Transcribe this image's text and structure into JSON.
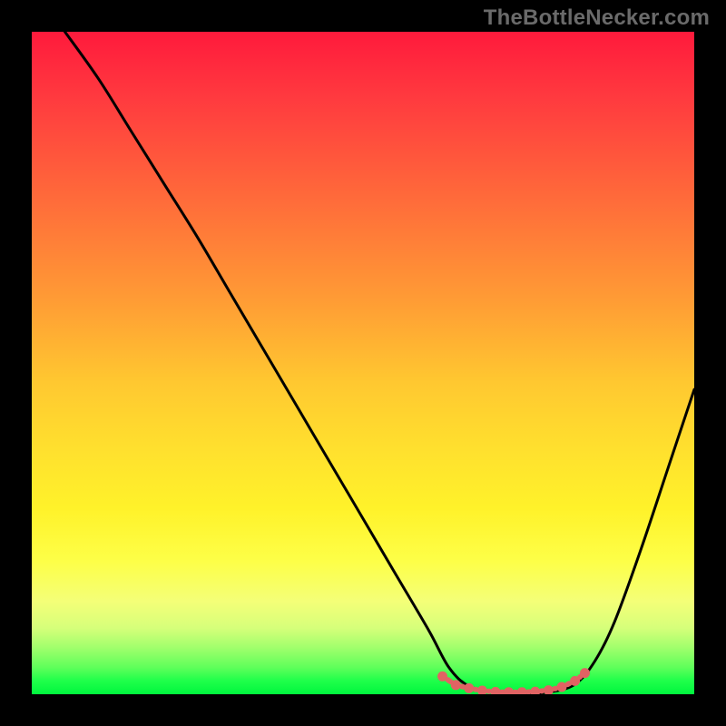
{
  "watermark": "TheBottleNecker.com",
  "colors": {
    "frame": "#000000",
    "curve": "#000000",
    "marker": "#e06363",
    "watermark": "#6a6a6a",
    "gradient_stops": [
      "#ff1a3c",
      "#ff3a3f",
      "#ff6a3a",
      "#ff9a35",
      "#ffc830",
      "#ffe02e",
      "#fff22a",
      "#fdff48",
      "#f4ff78",
      "#d6ff7a",
      "#a0ff6c",
      "#5eff5a",
      "#1eff4a",
      "#00f63e"
    ]
  },
  "chart_data": {
    "type": "line",
    "title": "",
    "xlabel": "",
    "ylabel": "",
    "xlim": [
      0,
      100
    ],
    "ylim": [
      0,
      100
    ],
    "series": [
      {
        "name": "curve",
        "x": [
          5,
          10,
          15,
          20,
          25,
          30,
          35,
          40,
          45,
          50,
          55,
          60,
          63,
          66,
          70,
          74,
          78,
          82,
          85,
          88,
          92,
          96,
          100
        ],
        "y": [
          100,
          93,
          85,
          77,
          69,
          60.5,
          52,
          43.5,
          35,
          26.5,
          18,
          9.5,
          4,
          1.2,
          0.3,
          0.2,
          0.3,
          1.5,
          5,
          11,
          22,
          34,
          46
        ]
      }
    ],
    "markers": {
      "name": "bottom-highlight",
      "style": "red-dots-and-dashes",
      "x": [
        62,
        64,
        66,
        68,
        70,
        72,
        74,
        76,
        78,
        80,
        82,
        83.5
      ],
      "y": [
        2.7,
        1.4,
        0.9,
        0.55,
        0.35,
        0.3,
        0.3,
        0.4,
        0.6,
        1.1,
        2.0,
        3.2
      ]
    },
    "background": {
      "type": "vertical-gradient",
      "meaning": "value-heat (red=high top, green=low bottom)"
    }
  }
}
